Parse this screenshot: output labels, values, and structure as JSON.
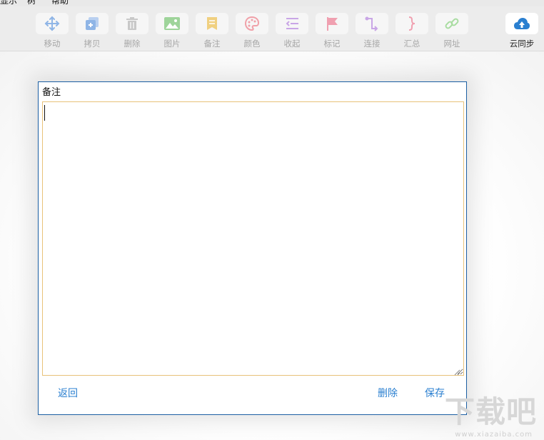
{
  "menubar": {
    "items": [
      "显示",
      "帮助"
    ]
  },
  "toolbar": {
    "tools": [
      {
        "label": "移动",
        "icon": "move-icon",
        "color": "#8fb5e6"
      },
      {
        "label": "拷贝",
        "icon": "copy-icon",
        "color": "#8fb5e6"
      },
      {
        "label": "删除",
        "icon": "trash-icon",
        "color": "#c8c8c8"
      },
      {
        "label": "图片",
        "icon": "image-icon",
        "color": "#9ed49a"
      },
      {
        "label": "备注",
        "icon": "note-icon",
        "color": "#f0d080"
      },
      {
        "label": "颜色",
        "icon": "palette-icon",
        "color": "#f0a0a8"
      },
      {
        "label": "收起",
        "icon": "collapse-icon",
        "color": "#c9a6e6"
      },
      {
        "label": "标记",
        "icon": "flag-icon",
        "color": "#f0a0b0"
      },
      {
        "label": "连接",
        "icon": "connect-icon",
        "color": "#c9a6e6"
      },
      {
        "label": "汇总",
        "icon": "brace-icon",
        "color": "#f0a0b0"
      },
      {
        "label": "网址",
        "icon": "link-icon",
        "color": "#a8dca0"
      }
    ],
    "sync": {
      "label": "云同步",
      "icon": "cloud-upload-icon",
      "color": "#2a7fd0"
    }
  },
  "dialog": {
    "title": "备注",
    "note_value": "",
    "back_label": "返回",
    "delete_label": "删除",
    "save_label": "保存"
  },
  "watermark": {
    "main": "下载吧",
    "sub": "www.xiazaiba.com"
  }
}
